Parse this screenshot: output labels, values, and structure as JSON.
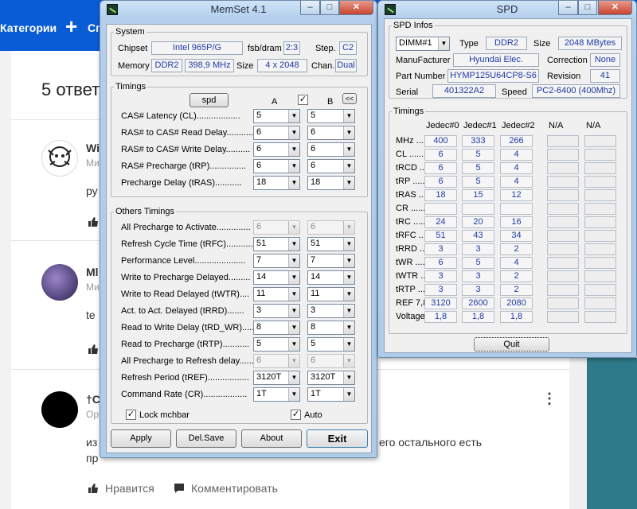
{
  "background_page": {
    "nav_categories": "Категории",
    "nav_create_partial": "Сп",
    "title": "5 ответ",
    "comments": [
      {
        "author_partial": "Wi",
        "meta_partial": "Ми",
        "text_partial": "ру"
      },
      {
        "author_partial": "Ml",
        "meta_partial": "Ми",
        "text_partial": "te"
      },
      {
        "author_partial": "†С",
        "meta_partial": "Ор",
        "text_left": "из",
        "text_right": "его остального есть",
        "text_line2": "пр"
      }
    ],
    "like_label": "Нравится",
    "comment_label": "Комментировать"
  },
  "memset": {
    "title": "MemSet 4.1",
    "system": {
      "legend": "System",
      "chipset_label": "Chipset",
      "chipset": "Intel 965P/G",
      "fsb_label": "fsb/dram",
      "fsb": "2:3",
      "step_label": "Step.",
      "step": "C2",
      "memory_label": "Memory",
      "memory_type": "DDR2",
      "memory_freq": "398,9 MHz",
      "size_label": "Size",
      "size": "4 x 2048",
      "chan_label": "Chan.",
      "chan": "Dual"
    },
    "timings": {
      "legend": "Timings",
      "spd_button": "spd",
      "col_a": "A",
      "col_b": "B",
      "link_checked": "✓",
      "collapse_button": "<<",
      "rows": [
        {
          "label": "CAS# Latency (CL)..................",
          "a": "5",
          "b": "5"
        },
        {
          "label": "RAS# to CAS# Read Delay...........",
          "a": "6",
          "b": "6"
        },
        {
          "label": "RAS# to CAS# Write Delay..........",
          "a": "6",
          "b": "6"
        },
        {
          "label": "RAS# Precharge (tRP)...............",
          "a": "6",
          "b": "6"
        },
        {
          "label": "Precharge Delay  (tRAS)...........",
          "a": "18",
          "b": "18"
        }
      ]
    },
    "others": {
      "legend": "Others Timings",
      "rows": [
        {
          "label": "All Precharge to Activate..............",
          "a": "6",
          "b": "6",
          "disabled": true
        },
        {
          "label": "Refresh Cycle Time (tRFC)...........",
          "a": "51",
          "b": "51"
        },
        {
          "label": "Performance Level.....................",
          "a": "7",
          "b": "7"
        },
        {
          "label": "Write to Precharge Delayed.........",
          "a": "14",
          "b": "14"
        },
        {
          "label": "Write to Read Delayed (tWTR)....",
          "a": "11",
          "b": "11"
        },
        {
          "label": "Act. to Act. Delayed (tRRD).......",
          "a": "3",
          "b": "3"
        },
        {
          "label": "Read to Write Delay (tRD_WR).....",
          "a": "8",
          "b": "8"
        },
        {
          "label": "Read to Precharge (tRTP)...........",
          "a": "5",
          "b": "5"
        },
        {
          "label": "All Precharge to Refresh delay.......",
          "a": "6",
          "b": "6",
          "disabled": true
        },
        {
          "label": "Refresh Period (tREF).................",
          "a": "3120T",
          "b": "3120T"
        },
        {
          "label": "Command Rate (CR)..................",
          "a": "1T",
          "b": "1T"
        }
      ],
      "lock_label": "Lock mchbar",
      "lock_checked": "✓",
      "auto_label": "Auto",
      "auto_checked": "✓"
    },
    "buttons": {
      "apply": "Apply",
      "delsave": "Del.Save",
      "about": "About",
      "exit": "Exit"
    }
  },
  "spd": {
    "title": "SPD",
    "infos": {
      "legend": "SPD Infos",
      "dimm": "DIMM#1",
      "type_label": "Type",
      "type": "DDR2",
      "size_label": "Size",
      "size": "2048 MBytes",
      "manufacturer_label": "ManuFacturer",
      "manufacturer": "Hyundai Elec.",
      "correction_label": "Correction",
      "correction": "None",
      "partnumber_label": "Part Number",
      "partnumber": "HYMP125U64CP8-S6",
      "revision_label": "Revision",
      "revision": "41",
      "serial_label": "Serial",
      "serial": "401322A2",
      "speed_label": "Speed",
      "speed": "PC2-6400 (400Mhz)"
    },
    "timings": {
      "legend": "Timings",
      "columns": [
        "Jedec#0",
        "Jedec#1",
        "Jedec#2",
        "N/A",
        "N/A"
      ],
      "rows": [
        {
          "label": "MHz ........",
          "v": [
            "400",
            "333",
            "266"
          ]
        },
        {
          "label": "CL .........",
          "v": [
            "6",
            "5",
            "4"
          ]
        },
        {
          "label": "tRCD ......",
          "v": [
            "6",
            "5",
            "4"
          ]
        },
        {
          "label": "tRP .......",
          "v": [
            "6",
            "5",
            "4"
          ]
        },
        {
          "label": "tRAS ......",
          "v": [
            "18",
            "15",
            "12"
          ]
        },
        {
          "label": "CR .........",
          "v": [
            "",
            "",
            ""
          ]
        },
        {
          "label": "tRC ........",
          "v": [
            "24",
            "20",
            "16"
          ]
        },
        {
          "label": "tRFC ......",
          "v": [
            "51",
            "43",
            "34"
          ]
        },
        {
          "label": "tRRD ......",
          "v": [
            "3",
            "3",
            "2"
          ]
        },
        {
          "label": "tWR .......",
          "v": [
            "6",
            "5",
            "4"
          ]
        },
        {
          "label": "tWTR ......",
          "v": [
            "3",
            "3",
            "2"
          ]
        },
        {
          "label": "tRTP ......",
          "v": [
            "3",
            "3",
            "2"
          ]
        },
        {
          "label": "REF 7,8",
          "v": [
            "3120",
            "2600",
            "2080"
          ]
        },
        {
          "label": "Voltage",
          "v": [
            "1,8",
            "1,8",
            "1,8"
          ]
        }
      ]
    },
    "quit_button": "Quit"
  }
}
